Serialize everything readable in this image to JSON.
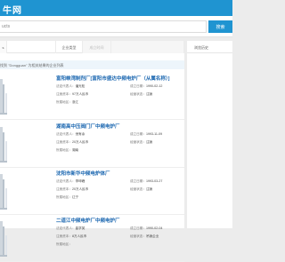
{
  "header": {
    "brand": "牛网"
  },
  "search": {
    "query": "ucts",
    "button_label": "搜索"
  },
  "tabs": [
    "s",
    "",
    "企业类型",
    "成立时间",
    ""
  ],
  "notice": "找到 \"Dongguan\" 为相关结果的企业列表",
  "companies": [
    {
      "name": "富阳峡湾制剂厂[富阳市盛达中频电炉厂（从属名称）]",
      "legal_rep": "潘光松",
      "founded": "1990-02-12",
      "capital": "97万人民币",
      "status": "注销",
      "region": "浙江"
    },
    {
      "name": "湖南高中压阀门厂中频电炉厂",
      "legal_rep": "倪有余",
      "founded": "1993-11-09",
      "capital": "20万人民币",
      "status": "注销",
      "region": "湖南"
    },
    {
      "name": "沈阳市新华中频电炉体厂",
      "legal_rep": "李坤峰",
      "founded": "1993-03-27",
      "capital": "20万人民币",
      "status": "注销",
      "region": "辽宁"
    },
    {
      "name": "二道江中频电炉厂中频电炉厂",
      "legal_rep": "曲学英",
      "founded": "1990-02-04",
      "capital": "8万人民币",
      "status": "吊销企业",
      "region": ""
    }
  ],
  "labels": {
    "legal_rep": "法定代表人：",
    "founded": "成立日期：",
    "capital": "注册资本：",
    "status": "经营状态：",
    "region": "所属地区："
  },
  "aside": {
    "title": "浏览历史"
  }
}
